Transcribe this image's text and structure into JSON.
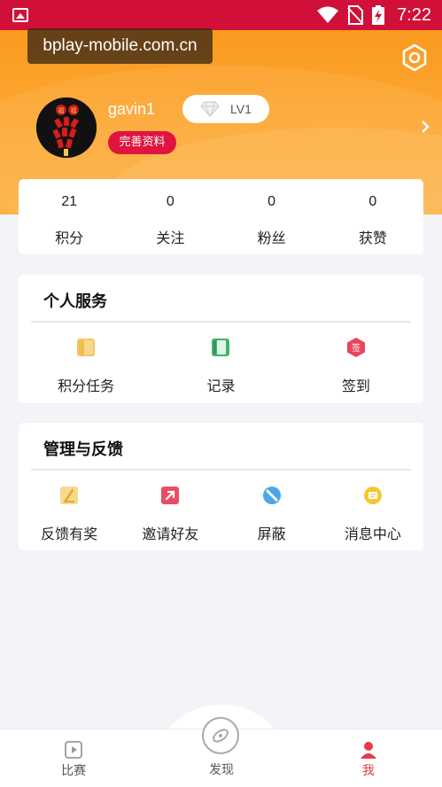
{
  "status_bar": {
    "time": "7:22"
  },
  "watermark": "bplay-mobile.com.cn",
  "profile": {
    "username": "gavin1",
    "level": "LV1",
    "complete_profile_label": "完善资料"
  },
  "stats": [
    {
      "value": "21",
      "label": "积分"
    },
    {
      "value": "0",
      "label": "关注"
    },
    {
      "value": "0",
      "label": "粉丝"
    },
    {
      "value": "0",
      "label": "获赞"
    }
  ],
  "personal_services": {
    "title": "个人服务",
    "items": [
      {
        "label": "积分任务",
        "icon": "points-task-icon",
        "color": "#f3c766"
      },
      {
        "label": "记录",
        "icon": "record-icon",
        "color": "#3db56a"
      },
      {
        "label": "签到",
        "icon": "checkin-icon",
        "color": "#e8465e",
        "glyph": "签"
      }
    ]
  },
  "feedback": {
    "title": "管理与反馈",
    "items": [
      {
        "label": "反馈有奖",
        "icon": "feedback-icon",
        "color": "#f4c566"
      },
      {
        "label": "邀请好友",
        "icon": "invite-icon",
        "color": "#ea4c68"
      },
      {
        "label": "屏蔽",
        "icon": "block-icon",
        "color": "#4aa6e8"
      },
      {
        "label": "消息中心",
        "icon": "message-icon",
        "color": "#f6c731"
      }
    ]
  },
  "bottom_nav": [
    {
      "label": "比赛",
      "icon": "match-icon"
    },
    {
      "label": "发现",
      "icon": "discover-icon"
    },
    {
      "label": "我",
      "icon": "me-icon",
      "active": true
    }
  ],
  "colors": {
    "status_bar": "#d1103a",
    "header_orange": "#fca935",
    "accent_red": "#e0143e",
    "active_nav": "#e63a4c"
  }
}
